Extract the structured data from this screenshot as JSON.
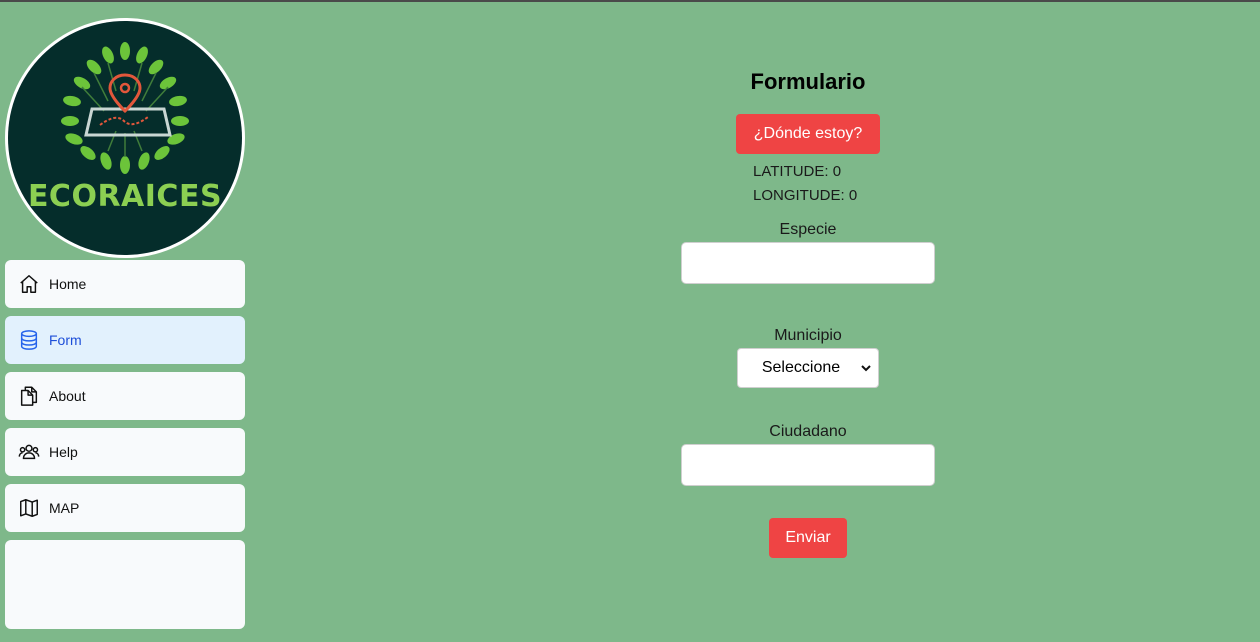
{
  "logo": {
    "text": "ECORAICES"
  },
  "nav": {
    "items": [
      {
        "label": "Home",
        "icon": "home-icon"
      },
      {
        "label": "Form",
        "icon": "database-icon"
      },
      {
        "label": "About",
        "icon": "documents-icon"
      },
      {
        "label": "Help",
        "icon": "users-icon"
      },
      {
        "label": "MAP",
        "icon": "map-icon"
      }
    ]
  },
  "form": {
    "title": "Formulario",
    "locate_button": "¿Dónde estoy?",
    "latitude": "LATITUDE: 0",
    "longitude": "LONGITUDE: 0",
    "species_label": "Especie",
    "species_value": "",
    "municipality_label": "Municipio",
    "municipality_selected": "Seleccione",
    "citizen_label": "Ciudadano",
    "citizen_value": "",
    "submit_button": "Enviar"
  },
  "colors": {
    "background": "#7eb88a",
    "accent": "#ef4444",
    "active_nav": "#e2f1fd",
    "active_text": "#1d4ed8"
  }
}
